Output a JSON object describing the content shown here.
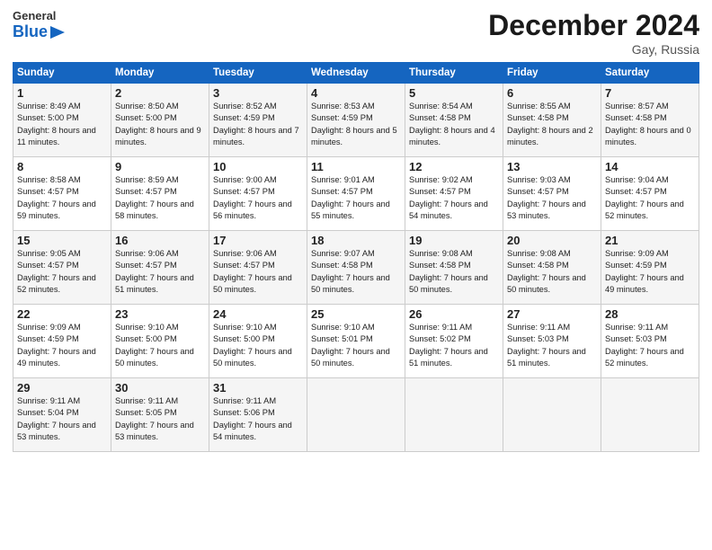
{
  "logo": {
    "general": "General",
    "blue": "Blue"
  },
  "title": "December 2024",
  "subtitle": "Gay, Russia",
  "columns": [
    "Sunday",
    "Monday",
    "Tuesday",
    "Wednesday",
    "Thursday",
    "Friday",
    "Saturday"
  ],
  "weeks": [
    [
      {
        "day": "1",
        "rise": "Sunrise: 8:49 AM",
        "set": "Sunset: 5:00 PM",
        "daylight": "Daylight: 8 hours and 11 minutes."
      },
      {
        "day": "2",
        "rise": "Sunrise: 8:50 AM",
        "set": "Sunset: 5:00 PM",
        "daylight": "Daylight: 8 hours and 9 minutes."
      },
      {
        "day": "3",
        "rise": "Sunrise: 8:52 AM",
        "set": "Sunset: 4:59 PM",
        "daylight": "Daylight: 8 hours and 7 minutes."
      },
      {
        "day": "4",
        "rise": "Sunrise: 8:53 AM",
        "set": "Sunset: 4:59 PM",
        "daylight": "Daylight: 8 hours and 5 minutes."
      },
      {
        "day": "5",
        "rise": "Sunrise: 8:54 AM",
        "set": "Sunset: 4:58 PM",
        "daylight": "Daylight: 8 hours and 4 minutes."
      },
      {
        "day": "6",
        "rise": "Sunrise: 8:55 AM",
        "set": "Sunset: 4:58 PM",
        "daylight": "Daylight: 8 hours and 2 minutes."
      },
      {
        "day": "7",
        "rise": "Sunrise: 8:57 AM",
        "set": "Sunset: 4:58 PM",
        "daylight": "Daylight: 8 hours and 0 minutes."
      }
    ],
    [
      {
        "day": "8",
        "rise": "Sunrise: 8:58 AM",
        "set": "Sunset: 4:57 PM",
        "daylight": "Daylight: 7 hours and 59 minutes."
      },
      {
        "day": "9",
        "rise": "Sunrise: 8:59 AM",
        "set": "Sunset: 4:57 PM",
        "daylight": "Daylight: 7 hours and 58 minutes."
      },
      {
        "day": "10",
        "rise": "Sunrise: 9:00 AM",
        "set": "Sunset: 4:57 PM",
        "daylight": "Daylight: 7 hours and 56 minutes."
      },
      {
        "day": "11",
        "rise": "Sunrise: 9:01 AM",
        "set": "Sunset: 4:57 PM",
        "daylight": "Daylight: 7 hours and 55 minutes."
      },
      {
        "day": "12",
        "rise": "Sunrise: 9:02 AM",
        "set": "Sunset: 4:57 PM",
        "daylight": "Daylight: 7 hours and 54 minutes."
      },
      {
        "day": "13",
        "rise": "Sunrise: 9:03 AM",
        "set": "Sunset: 4:57 PM",
        "daylight": "Daylight: 7 hours and 53 minutes."
      },
      {
        "day": "14",
        "rise": "Sunrise: 9:04 AM",
        "set": "Sunset: 4:57 PM",
        "daylight": "Daylight: 7 hours and 52 minutes."
      }
    ],
    [
      {
        "day": "15",
        "rise": "Sunrise: 9:05 AM",
        "set": "Sunset: 4:57 PM",
        "daylight": "Daylight: 7 hours and 52 minutes."
      },
      {
        "day": "16",
        "rise": "Sunrise: 9:06 AM",
        "set": "Sunset: 4:57 PM",
        "daylight": "Daylight: 7 hours and 51 minutes."
      },
      {
        "day": "17",
        "rise": "Sunrise: 9:06 AM",
        "set": "Sunset: 4:57 PM",
        "daylight": "Daylight: 7 hours and 50 minutes."
      },
      {
        "day": "18",
        "rise": "Sunrise: 9:07 AM",
        "set": "Sunset: 4:58 PM",
        "daylight": "Daylight: 7 hours and 50 minutes."
      },
      {
        "day": "19",
        "rise": "Sunrise: 9:08 AM",
        "set": "Sunset: 4:58 PM",
        "daylight": "Daylight: 7 hours and 50 minutes."
      },
      {
        "day": "20",
        "rise": "Sunrise: 9:08 AM",
        "set": "Sunset: 4:58 PM",
        "daylight": "Daylight: 7 hours and 50 minutes."
      },
      {
        "day": "21",
        "rise": "Sunrise: 9:09 AM",
        "set": "Sunset: 4:59 PM",
        "daylight": "Daylight: 7 hours and 49 minutes."
      }
    ],
    [
      {
        "day": "22",
        "rise": "Sunrise: 9:09 AM",
        "set": "Sunset: 4:59 PM",
        "daylight": "Daylight: 7 hours and 49 minutes."
      },
      {
        "day": "23",
        "rise": "Sunrise: 9:10 AM",
        "set": "Sunset: 5:00 PM",
        "daylight": "Daylight: 7 hours and 50 minutes."
      },
      {
        "day": "24",
        "rise": "Sunrise: 9:10 AM",
        "set": "Sunset: 5:00 PM",
        "daylight": "Daylight: 7 hours and 50 minutes."
      },
      {
        "day": "25",
        "rise": "Sunrise: 9:10 AM",
        "set": "Sunset: 5:01 PM",
        "daylight": "Daylight: 7 hours and 50 minutes."
      },
      {
        "day": "26",
        "rise": "Sunrise: 9:11 AM",
        "set": "Sunset: 5:02 PM",
        "daylight": "Daylight: 7 hours and 51 minutes."
      },
      {
        "day": "27",
        "rise": "Sunrise: 9:11 AM",
        "set": "Sunset: 5:03 PM",
        "daylight": "Daylight: 7 hours and 51 minutes."
      },
      {
        "day": "28",
        "rise": "Sunrise: 9:11 AM",
        "set": "Sunset: 5:03 PM",
        "daylight": "Daylight: 7 hours and 52 minutes."
      }
    ],
    [
      {
        "day": "29",
        "rise": "Sunrise: 9:11 AM",
        "set": "Sunset: 5:04 PM",
        "daylight": "Daylight: 7 hours and 53 minutes."
      },
      {
        "day": "30",
        "rise": "Sunrise: 9:11 AM",
        "set": "Sunset: 5:05 PM",
        "daylight": "Daylight: 7 hours and 53 minutes."
      },
      {
        "day": "31",
        "rise": "Sunrise: 9:11 AM",
        "set": "Sunset: 5:06 PM",
        "daylight": "Daylight: 7 hours and 54 minutes."
      },
      null,
      null,
      null,
      null
    ]
  ]
}
